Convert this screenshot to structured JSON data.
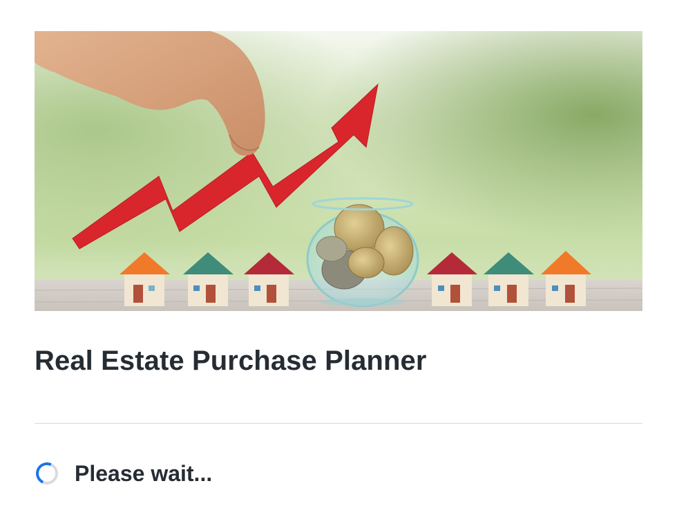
{
  "page": {
    "title": "Real Estate Purchase Planner",
    "status_text": "Please wait..."
  },
  "hero": {
    "image_name": "real-estate-growth-banner"
  },
  "colors": {
    "title_text": "#262c33",
    "divider": "#d7d9dc",
    "spinner_active": "#1a73e8",
    "spinner_track": "#d9dbdf",
    "arrow_red": "#d9262c"
  }
}
